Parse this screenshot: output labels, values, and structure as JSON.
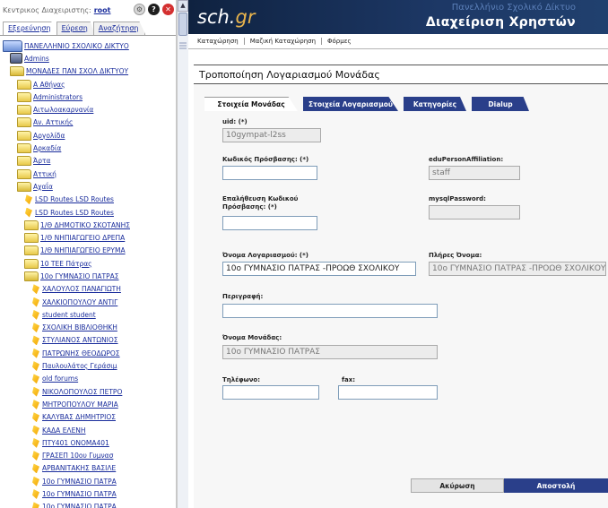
{
  "left": {
    "user_label": "Κεντρικος Διαχειριστης:",
    "user_name": "root",
    "tabs": [
      "Εξερεύνηση",
      "Εύρεση",
      "Αναζήτηση"
    ],
    "tree": [
      {
        "label": "ΠΑΝΕΛΛΗΝΙΟ ΣΧΟΛΙΚΟ ΔΙΚΤΥΟ",
        "icon": "network-folder-icon",
        "depth": 0
      },
      {
        "label": "Admins",
        "icon": "computer-icon",
        "depth": 1
      },
      {
        "label": "ΜΟΝΑΔΕΣ ΠΑΝ ΣΧΟΛ ΔΙΚΤΥΟΥ",
        "icon": "open-folder-icon",
        "depth": 1
      },
      {
        "label": "Α Αθήνας",
        "icon": "folder-icon",
        "depth": 2
      },
      {
        "label": "Administrators",
        "icon": "folder-icon",
        "depth": 2
      },
      {
        "label": "Αιτωλοακαρνανία",
        "icon": "folder-icon",
        "depth": 2
      },
      {
        "label": "Αν. Αττικής",
        "icon": "folder-icon",
        "depth": 2
      },
      {
        "label": "Αργολίδα",
        "icon": "folder-icon",
        "depth": 2
      },
      {
        "label": "Αρκαδία",
        "icon": "folder-icon",
        "depth": 2
      },
      {
        "label": "Άρτα",
        "icon": "folder-icon",
        "depth": 2
      },
      {
        "label": "Αττική",
        "icon": "folder-icon",
        "depth": 2
      },
      {
        "label": "Αχαΐα",
        "icon": "open-folder-icon",
        "depth": 2
      },
      {
        "label": "LSD Routes LSD Routes",
        "icon": "user-icon",
        "depth": 3
      },
      {
        "label": "LSD Routes LSD Routes",
        "icon": "user-icon",
        "depth": 3
      },
      {
        "label": "1/Θ ΔΗΜΟΤΙΚΟ ΣΚΟΤΑΝΗΣ",
        "icon": "folder-icon",
        "depth": 3
      },
      {
        "label": "1/Θ ΝΗΠΙΑΓΩΓΕΙΟ ΔΡΕΠΑ",
        "icon": "folder-icon",
        "depth": 3
      },
      {
        "label": "1/Θ ΝΗΠΙΑΓΩΓΕΙΟ ΕΡΥΜΑ",
        "icon": "folder-icon",
        "depth": 3
      },
      {
        "label": "10 ΤΕΕ Πάτρας",
        "icon": "folder-icon",
        "depth": 3
      },
      {
        "label": "10ο ΓΥΜΝΑΣΙΟ ΠΑΤΡΑΣ",
        "icon": "open-folder-icon",
        "depth": 3
      },
      {
        "label": "ΧΑΛΟΥΛΟΣ ΠΑΝΑΓΙΩΤΗ",
        "icon": "user-icon",
        "depth": 4
      },
      {
        "label": "ΧΑΛΚΙΟΠΟΥΛΟΥ ΑΝΤΙΓ",
        "icon": "user-icon",
        "depth": 4
      },
      {
        "label": "student student",
        "icon": "user-icon",
        "depth": 4
      },
      {
        "label": "ΣΧΟΛΙΚΗ ΒΙΒΛΙΟΘΗΚΗ",
        "icon": "user-icon",
        "depth": 4
      },
      {
        "label": "ΣΤΥΛΙΑΝΟΣ ΑΝΤΩΝΙΟΣ",
        "icon": "user-icon",
        "depth": 4
      },
      {
        "label": "ΠΑΤΡΩΝΗΣ ΘΕΟΔΩΡΟΣ",
        "icon": "user-icon",
        "depth": 4
      },
      {
        "label": "Παυλουλάτος Γεράσιμ",
        "icon": "user-icon",
        "depth": 4
      },
      {
        "label": "old forums",
        "icon": "user-icon",
        "depth": 4
      },
      {
        "label": "ΝΙΚΟΛΟΠΟΥΛΟΣ ΠΕΤΡΟ",
        "icon": "user-icon",
        "depth": 4
      },
      {
        "label": "ΜΗΤΡΟΠΟΥΛΟΥ ΜΑΡΙΑ",
        "icon": "user-icon",
        "depth": 4
      },
      {
        "label": "ΚΑΛΥΒΑΣ ΔΗΜΗΤΡΙΟΣ",
        "icon": "user-icon",
        "depth": 4
      },
      {
        "label": "ΚΑΔΑ ΕΛΕΝΗ",
        "icon": "user-icon",
        "depth": 4
      },
      {
        "label": "ΠΤΥ401 ΟΝΟΜΑ401",
        "icon": "user-icon",
        "depth": 4
      },
      {
        "label": "ΓΡΑΣΕΠ 10ου Γυμνασ",
        "icon": "user-icon",
        "depth": 4
      },
      {
        "label": "ΑΡΒΑΝΙΤΑΚΗΣ ΒΑΣΙΛΕ",
        "icon": "user-icon",
        "depth": 4
      },
      {
        "label": "10ο ΓΥΜΝΑΣΙΟ ΠΑΤΡΑ",
        "icon": "user-icon",
        "depth": 4
      },
      {
        "label": "10ο ΓΥΜΝΑΣΙΟ ΠΑΤΡΑ",
        "icon": "user-icon",
        "depth": 4
      },
      {
        "label": "10ο ΓΥΜΝΑΣΙΟ ΠΑΤΡΑ",
        "icon": "user-icon",
        "depth": 4
      }
    ]
  },
  "banner": {
    "logo_main": "sch.",
    "logo_tld": "gr",
    "subtitle": "Πανελλήνιο Σχολικό Δίκτυο",
    "title": "Διαχείριση Χρηστών"
  },
  "menu": [
    "Καταχώρηση",
    "Μαζική Καταχώρηση",
    "Φόρμες"
  ],
  "panel": {
    "title": "Τροποποίηση Λογαριασμού Μονάδας"
  },
  "tabs": [
    "Στοιχεία Μονάδας",
    "Στοιχεία Λογαριασμού",
    "Κατηγορίες",
    "Dialup"
  ],
  "form": {
    "uid_label": "uid: (*)",
    "uid_value": "10gympat-l2ss",
    "password_label": "Κωδικός Πρόσβασης: (*)",
    "affiliation_label": "eduPersonAffiliation:",
    "affiliation_value": "staff",
    "confirm_label": "Επαλήθευση Κωδικού Πρόσβασης: (*)",
    "mysql_label": "mysqlPassword:",
    "account_name_label": "Όνομα Λογαριασμού: (*)",
    "account_name_value": "10ο ΓΥΜΝΑΣΙΟ ΠΑΤΡΑΣ -ΠΡΟΩΘ ΣΧΟΛΙΚΟΥ",
    "full_name_label": "Πλήρες Όνομα:",
    "full_name_value": "10ο ΓΥΜΝΑΣΙΟ ΠΑΤΡΑΣ -ΠΡΟΩΘ ΣΧΟΛΙΚΟΥ",
    "description_label": "Περιγραφή:",
    "unit_name_label": "Όνομα Μονάδας:",
    "unit_name_value": "10ο ΓΥΜΝΑΣΙΟ ΠΑΤΡΑΣ",
    "phone_label": "Τηλέφωνο:",
    "fax_label": "fax:"
  },
  "buttons": {
    "cancel": "Ακύρωση",
    "submit": "Αποστολή"
  }
}
